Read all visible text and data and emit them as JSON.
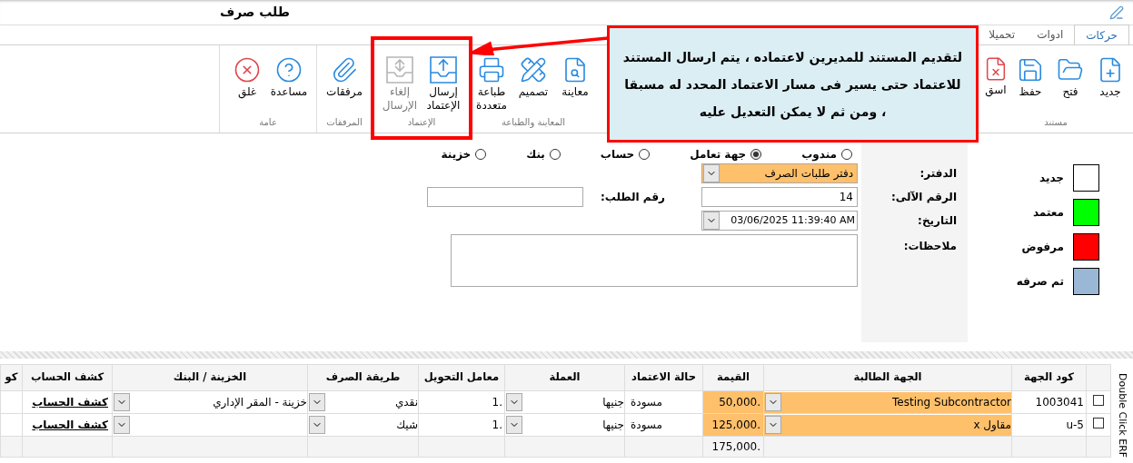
{
  "title": "طلب صرف",
  "tabs": [
    {
      "label": "حركات",
      "selected": true
    },
    {
      "label": "ادوات",
      "selected": false
    },
    {
      "label": "تحميلا",
      "selected": false
    }
  ],
  "ribbon_groups": [
    {
      "label": "مستند",
      "buttons": [
        {
          "label": "جديد",
          "disabled": false
        },
        {
          "label": "فتح",
          "disabled": false
        },
        {
          "label": "حفظ",
          "disabled": false
        },
        {
          "label": "اسق",
          "disabled": false
        }
      ]
    },
    {
      "label": "المعاينة والطباعة",
      "buttons": [
        {
          "label": "معاينة",
          "disabled": false
        },
        {
          "label": "تصميم",
          "disabled": false
        },
        {
          "label": "طباعة متعددة",
          "disabled": false
        }
      ]
    },
    {
      "label": "الإعتماد",
      "buttons": [
        {
          "label": "إرسال الإعتماد",
          "disabled": false
        },
        {
          "label": "إلغاء الإرسال",
          "disabled": true
        }
      ]
    },
    {
      "label": "المرفقات",
      "buttons": [
        {
          "label": "مرفقات",
          "disabled": false
        }
      ]
    },
    {
      "label": "عامة",
      "buttons": [
        {
          "label": "مساعدة",
          "disabled": false
        },
        {
          "label": "غلق",
          "disabled": false
        }
      ]
    }
  ],
  "callout": {
    "text": "لتقديم المستند للمديرين لاعتماده ، يتم ارسال المستند للاعتماد حتى يسير فى مسار الاعتماد المحدد له مسبقا ، ومن ثم لا يمكن التعديل عليه"
  },
  "radios": [
    {
      "label": "مندوب",
      "selected": false
    },
    {
      "label": "جهة تعامل",
      "selected": true
    },
    {
      "label": "حساب",
      "selected": false
    },
    {
      "label": "بنك",
      "selected": false
    },
    {
      "label": "خزينة",
      "selected": false
    }
  ],
  "form": {
    "book": {
      "label": "الدفتر:",
      "value": "دفتر طلبات الصرف"
    },
    "auto_number": {
      "label": "الرقم الآلى:",
      "value": "14"
    },
    "request_number": {
      "label": "رقم الطلب:"
    },
    "date": {
      "label": "التاريخ:",
      "value": "03/06/2025 11:39:40 AM"
    },
    "notes": {
      "label": "ملاحظات:"
    }
  },
  "legend": [
    {
      "label": "جديد",
      "color": "#ffffff"
    },
    {
      "label": "معتمد",
      "color": "#00ff00"
    },
    {
      "label": "مرفوض",
      "color": "#ff0000"
    },
    {
      "label": "تم صرفه",
      "color": "#9ab8d6"
    }
  ],
  "grid": {
    "columns": [
      "",
      "كود الجهة",
      "الجهة الطالبة",
      "القيمة",
      "حالة الاعتماد",
      "العملة",
      "معامل التحويل",
      "طريقة الصرف",
      "الخزينة / البنك",
      "كشف الحساب",
      "كو"
    ],
    "rows": [
      {
        "checked": false,
        "code": "1003041",
        "party": "Testing Subcontractor",
        "amount": "50,000.",
        "status": "مسودة",
        "currency": "جنيها",
        "rate": "1.",
        "method": "نقدي",
        "treasury": "خزينة - المقر الإداري",
        "statement": "كشف الحساب"
      },
      {
        "checked": false,
        "code": "u-5",
        "party": "مقاول x",
        "amount": "125,000.",
        "status": "مسودة",
        "currency": "جنيها",
        "rate": "1.",
        "method": "شيك",
        "treasury": "",
        "statement": "كشف الحساب"
      }
    ],
    "total": "175,000.",
    "side_label": "Double Click ERF"
  }
}
